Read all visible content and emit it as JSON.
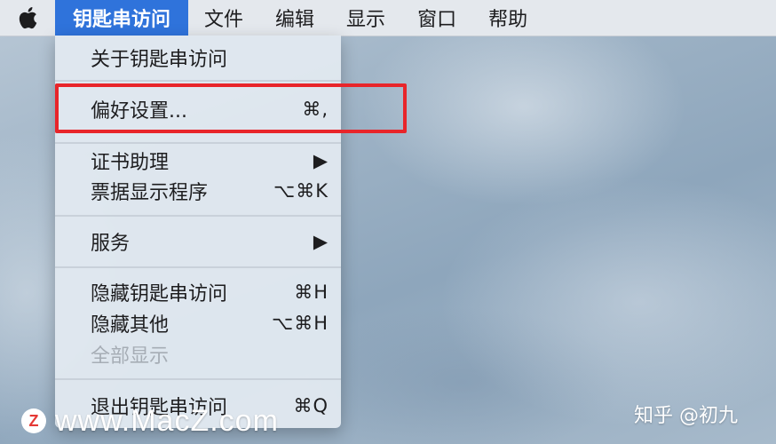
{
  "menubar": {
    "items": [
      "钥匙串访问",
      "文件",
      "编辑",
      "显示",
      "窗口",
      "帮助"
    ]
  },
  "dropdown": {
    "about": "关于钥匙串访问",
    "preferences": {
      "label": "偏好设置...",
      "shortcut": "⌘,"
    },
    "cert_assistant": {
      "label": "证书助理",
      "arrow": "▶"
    },
    "ticket_viewer": {
      "label": "票据显示程序",
      "shortcut": "⌥⌘K"
    },
    "services": {
      "label": "服务",
      "arrow": "▶"
    },
    "hide_app": {
      "label": "隐藏钥匙串访问",
      "shortcut": "⌘H"
    },
    "hide_others": {
      "label": "隐藏其他",
      "shortcut": "⌥⌘H"
    },
    "show_all": "全部显示",
    "quit": {
      "label": "退出钥匙串访问",
      "shortcut": "⌘Q"
    }
  },
  "watermark": {
    "logo_letter": "Z",
    "site": "www.MacZ.com",
    "zhihu": "知乎 @初九"
  },
  "colors": {
    "menu_active": "#2f73db",
    "highlight_border": "#e8252a"
  }
}
